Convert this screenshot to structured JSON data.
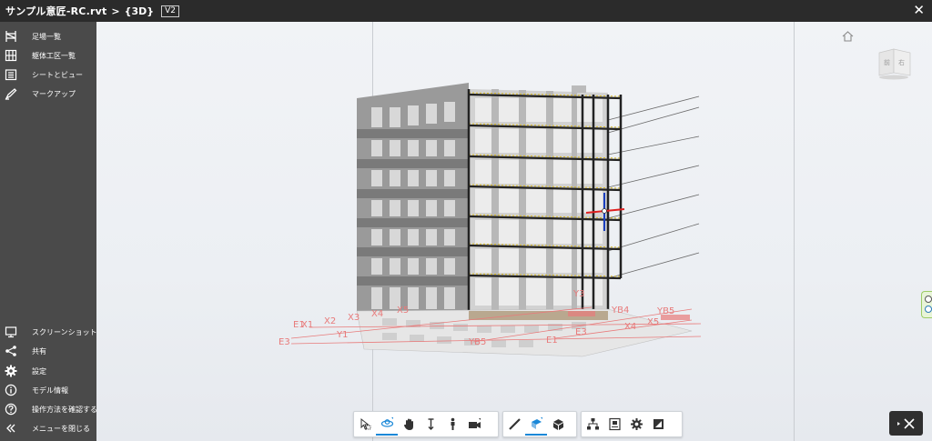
{
  "header": {
    "file_title": "サンプル意匠-RC.rvt",
    "separator": ">",
    "view_name": "{3D}",
    "version_badge": "V2",
    "close_icon": "close-icon"
  },
  "sidebar": {
    "top_items": [
      {
        "label": "足場一覧",
        "icon": "scaffold-icon"
      },
      {
        "label": "躯体工区一覧",
        "icon": "grid-section-icon"
      },
      {
        "label": "シートとビュー",
        "icon": "sheets-icon"
      },
      {
        "label": "マークアップ",
        "icon": "markup-icon"
      }
    ],
    "bottom_items": [
      {
        "label": "スクリーンショット",
        "icon": "screenshot-icon"
      },
      {
        "label": "共有",
        "icon": "share-icon"
      },
      {
        "label": "設定",
        "icon": "gear-icon"
      },
      {
        "label": "モデル情報",
        "icon": "info-icon"
      },
      {
        "label": "操作方法を確認する",
        "icon": "help-icon"
      },
      {
        "label": "メニューを閉じる",
        "icon": "collapse-icon"
      }
    ]
  },
  "viewport": {
    "grid_labels": {
      "y_left": [
        "E1",
        "X1",
        "X2",
        "X3",
        "X4",
        "X5",
        "E3",
        "Y1"
      ],
      "front": [
        "YB5",
        "E1"
      ],
      "right": [
        "Y3",
        "YB4",
        "YB5",
        "X4",
        "X5",
        "E3"
      ]
    },
    "annotation_color": "#e87a7a",
    "section_box_color": "#1a3fbf",
    "axis_x_color": "#e02020"
  },
  "viewcube": {
    "face_left": "前",
    "face_right": "右"
  },
  "toolbar": {
    "group1": [
      "select-icon",
      "orbit-icon",
      "pan-icon",
      "zoom-icon",
      "first-person-icon",
      "camera-icon"
    ],
    "group2": [
      "measure-icon",
      "section-icon",
      "explode-icon"
    ],
    "group3": [
      "model-browser-icon",
      "properties-icon",
      "settings-icon",
      "fullscreen-icon"
    ],
    "active": "orbit-icon",
    "accent": "#1a88d8"
  }
}
